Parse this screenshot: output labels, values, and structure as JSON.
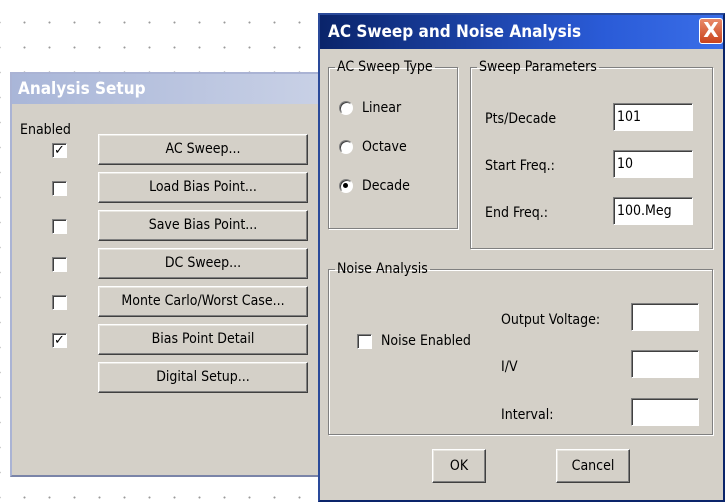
{
  "analysis_setup": {
    "title": "Analysis Setup",
    "enabled_label": "Enabled",
    "rows": [
      {
        "checked": true,
        "label": "AC Sweep..."
      },
      {
        "checked": false,
        "label": "Load Bias Point..."
      },
      {
        "checked": false,
        "label": "Save Bias Point..."
      },
      {
        "checked": false,
        "label": "DC Sweep..."
      },
      {
        "checked": false,
        "label": "Monte Carlo/Worst Case..."
      },
      {
        "checked": true,
        "label": "Bias Point Detail"
      }
    ],
    "digital_setup_label": "Digital Setup..."
  },
  "ac_dialog": {
    "title": "AC Sweep and Noise Analysis",
    "close_glyph": "X",
    "sweep_type": {
      "legend": "AC Sweep Type",
      "options": [
        "Linear",
        "Octave",
        "Decade"
      ],
      "selected": "Decade"
    },
    "sweep_params": {
      "legend": "Sweep Parameters",
      "pts_label": "Pts/Decade",
      "pts_value": "101",
      "start_label": "Start Freq.:",
      "start_value": "10",
      "end_label": "End Freq.:",
      "end_value": "100.Meg"
    },
    "noise": {
      "legend": "Noise Analysis",
      "enabled_label": "Noise Enabled",
      "enabled": false,
      "output_label": "Output Voltage:",
      "output_value": "",
      "iv_label": "I/V",
      "iv_value": "",
      "interval_label": "Interval:",
      "interval_value": ""
    },
    "ok_label": "OK",
    "cancel_label": "Cancel"
  },
  "colors": {
    "active_title": "#0a246a",
    "inactive_title": "#a9b6d8",
    "dialog_face": "#d4d0c8",
    "close_button": "#c9421c"
  }
}
